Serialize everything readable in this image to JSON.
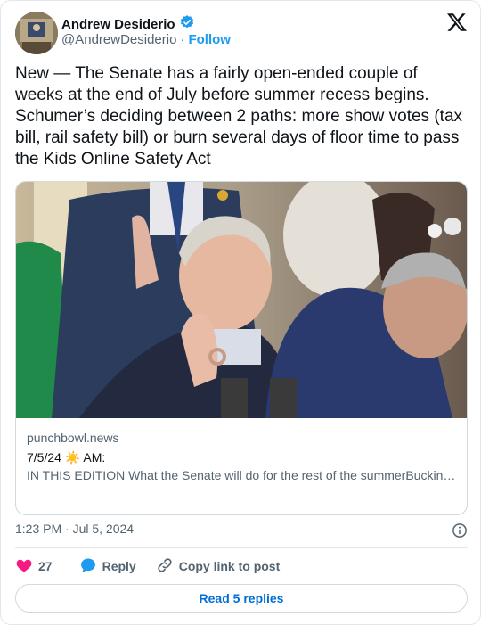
{
  "author": {
    "name": "Andrew Desiderio",
    "handle": "@AndrewDesiderio",
    "separator": "·",
    "follow_label": "Follow",
    "verified": true
  },
  "tweet": {
    "text": "New — The Senate has a fairly open-ended couple of weeks at the end of July before summer recess begins. Schumer’s deciding between 2 paths: more show votes (tax bill, rail safety bill) or burn several days of floor time to pass the Kids Online Safety Act"
  },
  "link_card": {
    "domain": "punchbowl.news",
    "title_prefix": "7/5/24",
    "title_suffix": "AM:",
    "sun_emoji": "☀️",
    "description": "IN THIS EDITION What the Senate will do for the rest of the summerBucking recent history, Romney’s successor won’t be a MAGA ..."
  },
  "timestamp": "1:23 PM · Jul 5, 2024",
  "actions": {
    "like_count": "27",
    "reply_label": "Reply",
    "copy_label": "Copy link to post"
  },
  "read_replies_label": "Read 5 replies",
  "colors": {
    "accent": "#1d9bf0",
    "like": "#f91880",
    "read_replies": "#006fd6"
  }
}
